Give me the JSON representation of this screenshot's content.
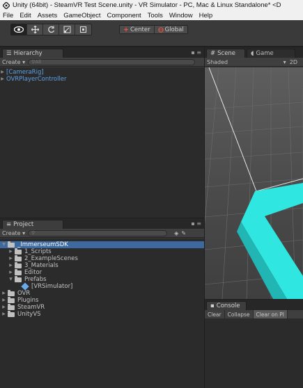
{
  "window": {
    "title": "Unity (64bit) - SteamVR Test Scene.unity - VR Simulator - PC, Mac & Linux Standalone* <D"
  },
  "menu": [
    "File",
    "Edit",
    "Assets",
    "GameObject",
    "Component",
    "Tools",
    "Window",
    "Help"
  ],
  "toolbar": {
    "pivot": {
      "center": "Center",
      "global": "Global"
    }
  },
  "hierarchy": {
    "tab": "Hierarchy",
    "create": "Create",
    "search_placeholder": "All",
    "items": [
      "[CameraRig]",
      "OVRPlayerController"
    ]
  },
  "scene": {
    "tab": "Scene",
    "game_tab": "Game",
    "shading": "Shaded",
    "mode_2d": "2D"
  },
  "project": {
    "tab": "Project",
    "create": "Create",
    "root": "_ImmerseumSDK",
    "children": [
      "1_Scripts",
      "2_ExampleScenes",
      "3_Materials",
      "Editor"
    ],
    "prefabs_folder": "Prefabs",
    "prefab_item": "[VRSimulator]",
    "top_level": [
      "OVR",
      "Plugins",
      "SteamVR",
      "UnityVS"
    ]
  },
  "console": {
    "tab": "Console",
    "buttons": [
      "Clear",
      "Collapse",
      "Clear on Pl"
    ]
  },
  "colors": {
    "accent_blue": "#5ea0e6",
    "selection": "#3c6aa0",
    "cyan_plane": "#2fe6e0"
  }
}
